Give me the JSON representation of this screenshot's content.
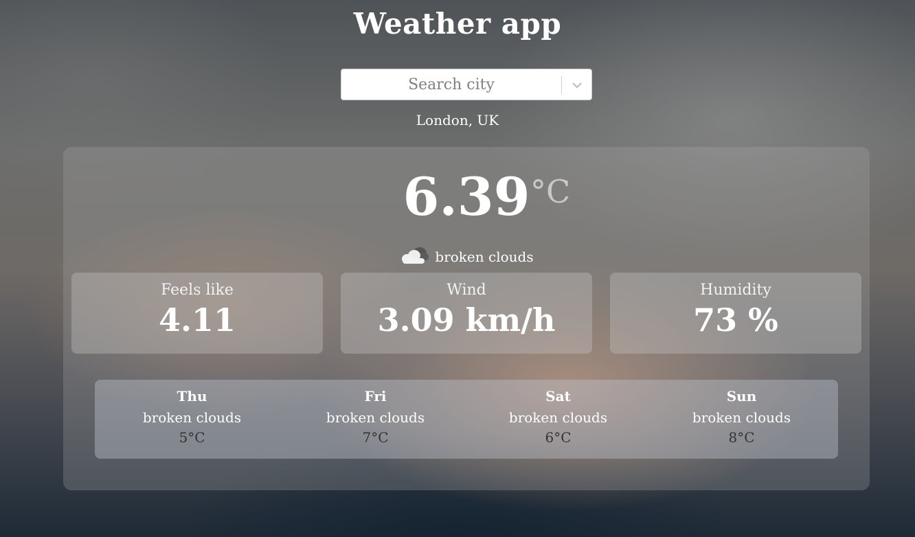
{
  "app": {
    "title": "Weather app"
  },
  "search": {
    "placeholder": "Search city"
  },
  "location": "London, UK",
  "current": {
    "temperature": "6.39",
    "unit": "°C",
    "description": "broken clouds",
    "icon": "broken-clouds-icon"
  },
  "stats": [
    {
      "label": "Feels like",
      "value": "4.11"
    },
    {
      "label": "Wind",
      "value": "3.09 km/h"
    },
    {
      "label": "Humidity",
      "value": "73 %"
    }
  ],
  "forecast": [
    {
      "day": "Thu",
      "description": "broken clouds",
      "temp": "5°C"
    },
    {
      "day": "Fri",
      "description": "broken clouds",
      "temp": "7°C"
    },
    {
      "day": "Sat",
      "description": "broken clouds",
      "temp": "6°C"
    },
    {
      "day": "Sun",
      "description": "broken clouds",
      "temp": "8°C"
    }
  ]
}
